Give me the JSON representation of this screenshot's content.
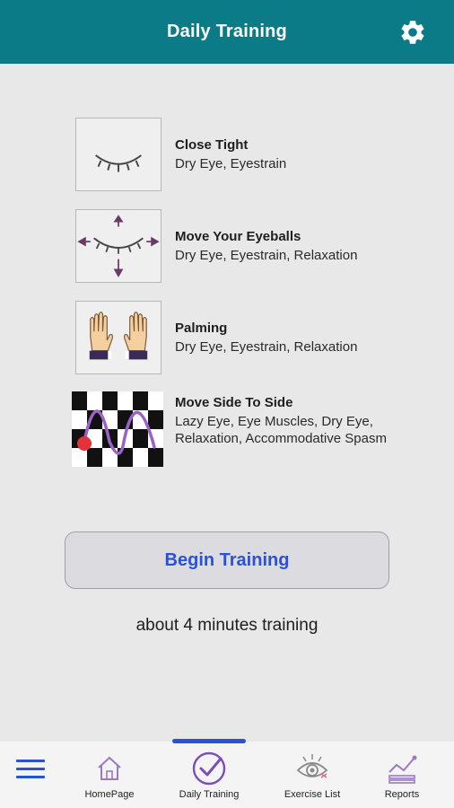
{
  "header": {
    "title": "Daily Training",
    "settings_icon": "gear-icon",
    "background": "#0b7b87"
  },
  "exercises": [
    {
      "title": "Close Tight",
      "tags": "Dry Eye, Eyestrain",
      "icon": "closed-eye-icon"
    },
    {
      "title": "Move Your Eyeballs",
      "tags": "Dry Eye, Eyestrain, Relaxation",
      "icon": "eye-movement-arrows-icon"
    },
    {
      "title": "Palming",
      "tags": "Dry Eye, Eyestrain, Relaxation",
      "icon": "palming-hands-icon"
    },
    {
      "title": "Move Side To Side",
      "tags": "Lazy Eye, Eye Muscles, Dry Eye, Relaxation, Accommodative Spasm",
      "icon": "checkerboard-bounce-icon"
    }
  ],
  "begin_button": {
    "label": "Begin Training",
    "color": "#2a52d8"
  },
  "duration_text": "about 4 minutes training",
  "bottom_nav": {
    "items": [
      {
        "label": "HomePage",
        "icon": "house-icon"
      },
      {
        "label": "Daily Training",
        "icon": "check-circle-icon",
        "active": true
      },
      {
        "label": "Exercise List",
        "icon": "eye-icon"
      },
      {
        "label": "Reports",
        "icon": "chart-icon"
      }
    ],
    "accent": "#2a52d8"
  }
}
